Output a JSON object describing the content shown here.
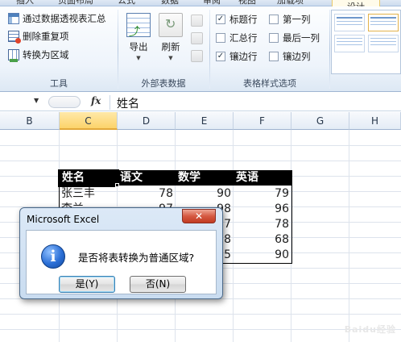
{
  "ribbon": {
    "tabs": [
      {
        "label": "插入"
      },
      {
        "label": "页面布局"
      },
      {
        "label": "公式"
      },
      {
        "label": "数据"
      },
      {
        "label": "审阅"
      },
      {
        "label": "视图"
      },
      {
        "label": "加载项"
      },
      {
        "label": "设计",
        "active": true
      }
    ],
    "tools": {
      "label": "工具",
      "pivot_label": "通过数据透视表汇总",
      "dedupe_label": "删除重复项",
      "convert_label": "转换为区域"
    },
    "external": {
      "label": "外部表数据",
      "export_label": "导出",
      "refresh_label": "刷新"
    },
    "style_options": {
      "label": "表格样式选项",
      "header_row": {
        "label": "标题行",
        "checked": true
      },
      "total_row": {
        "label": "汇总行",
        "checked": false
      },
      "banded_rows": {
        "label": "镶边行",
        "checked": true
      },
      "first_column": {
        "label": "第一列",
        "checked": false
      },
      "last_column": {
        "label": "最后一列",
        "checked": false
      },
      "banded_columns": {
        "label": "镶边列",
        "checked": false
      }
    },
    "check_mark": "✓"
  },
  "formula_bar": {
    "fx_label": "fx",
    "value": "姓名"
  },
  "columns": [
    "B",
    "C",
    "D",
    "E",
    "F",
    "G",
    "H"
  ],
  "active_column": "C",
  "table": {
    "headers": [
      "姓名",
      "语文",
      "数学",
      "英语"
    ],
    "rows": [
      [
        "张三丰",
        "78",
        "90",
        "79"
      ],
      [
        "李兰",
        "97",
        "98",
        "96"
      ],
      [
        "",
        "",
        "7",
        "78"
      ],
      [
        "",
        "",
        "8",
        "68"
      ],
      [
        "",
        "",
        "5",
        "90"
      ]
    ]
  },
  "dialog": {
    "title": "Microsoft Excel",
    "close_label": "✕",
    "icon_label": "i",
    "message": "是否将表转换为普通区域?",
    "yes_label": "是(Y)",
    "no_label": "否(N)"
  },
  "watermark": "Baidu经验",
  "colors": {
    "table_header_bg": "#000000",
    "selection_border": "#000000",
    "dialog_close": "#c23b22",
    "ribbon_bg": "#eef4fb"
  }
}
